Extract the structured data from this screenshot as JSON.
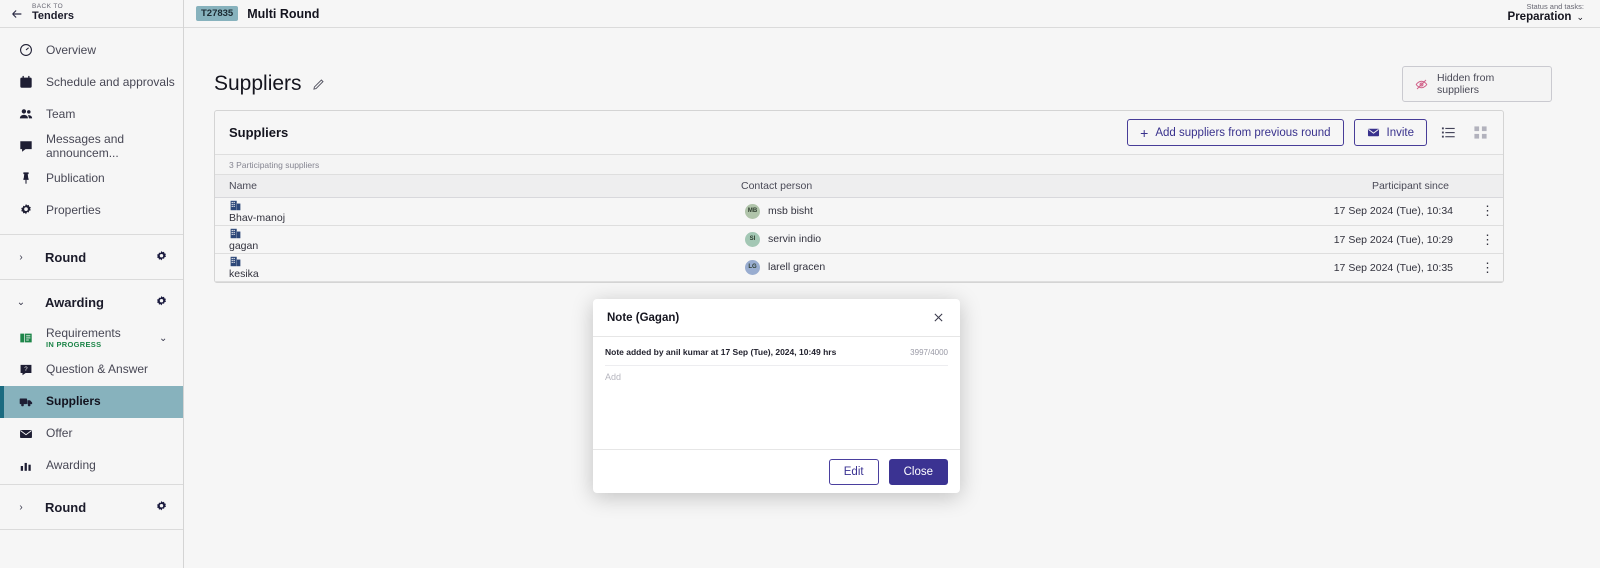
{
  "sidebar": {
    "back": {
      "kicker": "BACK TO",
      "title": "Tenders"
    },
    "items": [
      {
        "label": "Overview",
        "icon": "gauge-icon"
      },
      {
        "label": "Schedule and approvals",
        "icon": "calendar-clock-icon"
      },
      {
        "label": "Team",
        "icon": "people-icon"
      },
      {
        "label": "Messages and announcem...",
        "icon": "chat-icon"
      },
      {
        "label": "Publication",
        "icon": "pin-icon"
      },
      {
        "label": "Properties",
        "icon": "gear-icon"
      }
    ],
    "round_top": {
      "label": "Round",
      "collapsed": true
    },
    "awarding": {
      "label": "Awarding",
      "expanded": true
    },
    "awarding_items": [
      {
        "label": "Requirements",
        "status": "IN PROGRESS",
        "icon": "requirements-icon",
        "active": false,
        "expandable": true
      },
      {
        "label": "Question & Answer",
        "status": "",
        "icon": "question-answer-icon",
        "active": false,
        "expandable": false
      },
      {
        "label": "Suppliers",
        "status": "",
        "icon": "truck-icon",
        "active": true,
        "expandable": false
      },
      {
        "label": "Offer",
        "status": "",
        "icon": "envelope-icon",
        "active": false,
        "expandable": false
      },
      {
        "label": "Awarding",
        "status": "",
        "icon": "bar-chart-icon",
        "active": false,
        "expandable": false
      }
    ],
    "round_bottom": {
      "label": "Round",
      "collapsed": true
    }
  },
  "topbar": {
    "tender_id": "T27835",
    "tender_title": "Multi Round",
    "status_kicker": "Status and tasks:",
    "status_value": "Preparation"
  },
  "page": {
    "title": "Suppliers",
    "hidden_chip": "Hidden from suppliers"
  },
  "card": {
    "title": "Suppliers",
    "add_button": "Add suppliers from previous round",
    "invite_button": "Invite",
    "participating_label": "3 Participating suppliers",
    "columns": [
      "Name",
      "Contact person",
      "Participant since"
    ],
    "rows": [
      {
        "name": "Bhav-manoj",
        "contact": "msb bisht",
        "initials": "MB",
        "avatar_color": "#b7cbb0",
        "since": "17 Sep 2024 (Tue), 10:34"
      },
      {
        "name": "gagan",
        "contact": "servin indio",
        "initials": "SI",
        "avatar_color": "#a9cfbb",
        "since": "17 Sep 2024 (Tue), 10:29"
      },
      {
        "name": "kesika",
        "contact": "larell gracen",
        "initials": "LG",
        "avatar_color": "#9fb4d8",
        "since": "17 Sep 2024 (Tue), 10:35"
      }
    ]
  },
  "modal": {
    "title": "Note (Gagan)",
    "note_meta": "Note added by anil kumar at 17 Sep (Tue), 2024, 10:49 hrs",
    "char_count": "3997/4000",
    "input_placeholder": "Add",
    "input_value": "",
    "edit_button": "Edit",
    "close_button": "Close"
  },
  "colors": {
    "accent_purple": "#3b3392",
    "active_teal": "#8cb9c4",
    "active_teal_bar": "#1b6f85",
    "status_green": "#1e8a4b",
    "hidden_pink": "#d9648e"
  }
}
